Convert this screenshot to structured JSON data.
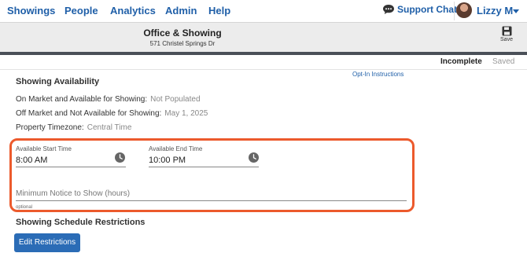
{
  "nav": {
    "items": [
      "Showings",
      "People",
      "Analytics",
      "Admin",
      "Help"
    ],
    "support_label": "Support Chat",
    "user_name": "Lizzy M"
  },
  "header": {
    "title": "Office & Showing",
    "subtitle": "571 Christel Springs Dr",
    "save_label": "Save"
  },
  "status": {
    "incomplete": "Incomplete",
    "saved": "Saved"
  },
  "availability": {
    "title": "Showing Availability",
    "optin_link": "Opt-In Instructions",
    "on_market_label": "On Market and Available for Showing:",
    "on_market_value": "Not Populated",
    "off_market_label": "Off Market and Not Available for Showing:",
    "off_market_value": "May 1, 2025",
    "timezone_label": "Property Timezone:",
    "timezone_value": "Central Time"
  },
  "times": {
    "start_label": "Available Start Time",
    "start_value": "8:00 AM",
    "end_label": "Available End Time",
    "end_value": "10:00 PM",
    "min_notice_placeholder": "Minimum Notice to Show (hours)",
    "optional_label": "optional"
  },
  "restrictions": {
    "title": "Showing Schedule Restrictions",
    "edit_button": "Edit Restrictions"
  },
  "colors": {
    "link": "#1f5fa8",
    "highlight": "#ec5a2c",
    "button": "#2b6cb6"
  }
}
